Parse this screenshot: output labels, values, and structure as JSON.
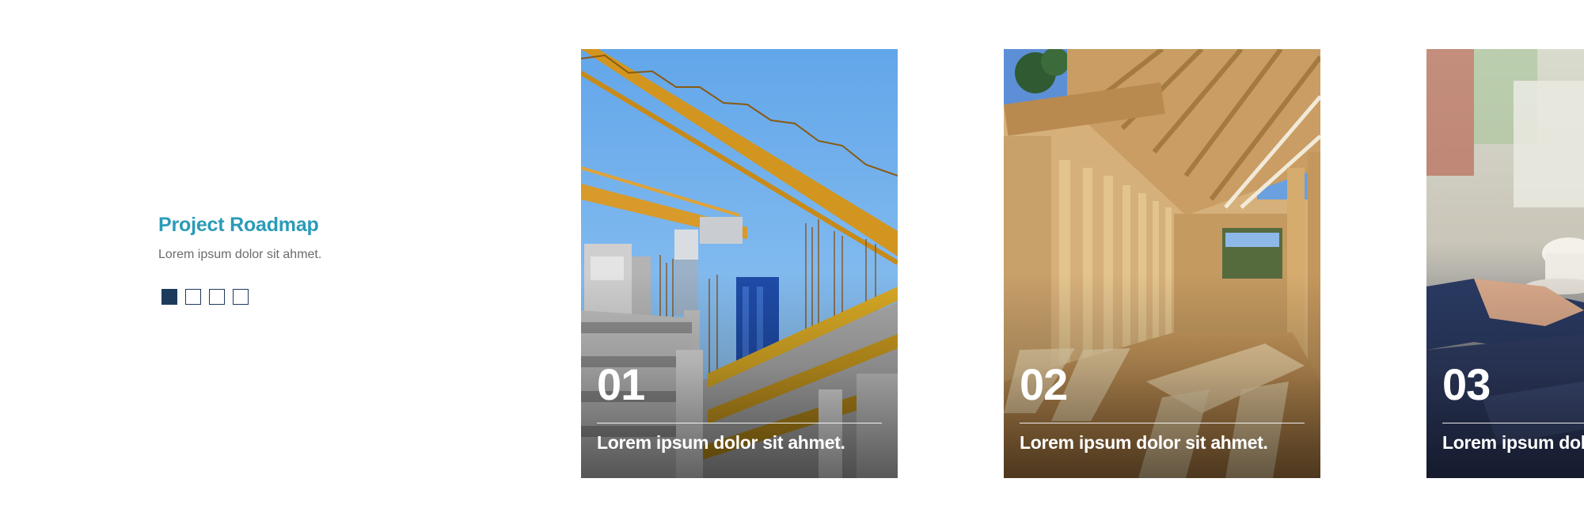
{
  "intro": {
    "title": "Project Roadmap",
    "subtitle": "Lorem ipsum dolor sit ahmet."
  },
  "pager": {
    "count": 4,
    "active_index": 0
  },
  "cards": [
    {
      "number": "01",
      "caption": "Lorem ipsum dolor sit ahmet.",
      "image": "construction-crane-building-photo"
    },
    {
      "number": "02",
      "caption": "Lorem ipsum dolor sit ahmet.",
      "image": "wooden-house-framing-interior-photo"
    },
    {
      "number": "03",
      "caption": "Lorem ipsum dolor sit ahmet.",
      "image": "people-meeting-with-coffee-photo"
    }
  ],
  "colors": {
    "title_accent": "#2a9bb8",
    "pager_active": "#1b3a5c",
    "pager_border": "#1e3a5f",
    "subtitle_text": "#6b6b6b"
  }
}
